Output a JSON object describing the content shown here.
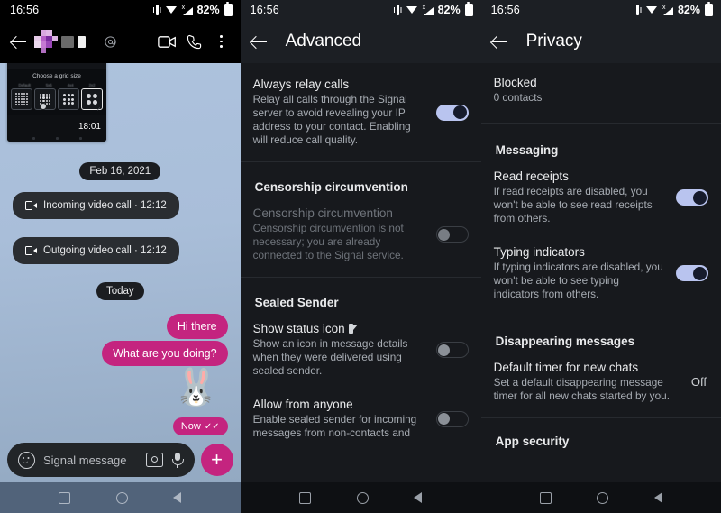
{
  "status_bar": {
    "time": "16:56",
    "battery_percent": "82%",
    "icons": [
      "vibrate-icon",
      "wifi-icon",
      "cellular-signal-icon",
      "battery-icon"
    ]
  },
  "left_panel": {
    "toolbar": {
      "back_icon": "back-arrow-icon",
      "avatar": "contact-avatar-pixelated",
      "contact_name_redacted": true,
      "at_icon": "mention-icon",
      "video_call_icon": "video-camera-icon",
      "voice_call_icon": "phone-icon",
      "overflow_icon": "more-vertical-icon"
    },
    "thumbnail": {
      "title": "Choose a grid size",
      "options": [
        "Default",
        "5x5",
        "4x4",
        "2x2"
      ],
      "selected_option": "2x2",
      "timestamp": "18:01"
    },
    "messages": [
      {
        "type": "date",
        "text": "Feb 16, 2021"
      },
      {
        "type": "call",
        "icon": "video-call-icon",
        "text": "Incoming video call · 12:12"
      },
      {
        "type": "call",
        "icon": "video-call-icon",
        "text": "Outgoing video call · 12:12"
      },
      {
        "type": "date",
        "text": "Today"
      },
      {
        "type": "outgoing",
        "text": "Hi there"
      },
      {
        "type": "outgoing",
        "text": "What are you doing?"
      },
      {
        "type": "emoji",
        "text": "🐰"
      },
      {
        "type": "status",
        "text": "Now",
        "delivery": "✓✓"
      }
    ],
    "composer": {
      "emoji_icon": "emoji-smiley-icon",
      "placeholder": "Signal message",
      "camera_icon": "camera-icon",
      "mic_icon": "microphone-icon",
      "attach_label": "+"
    },
    "accent_color": "#c4247f",
    "wallpaper_color": "#a9bed9"
  },
  "mid_panel": {
    "title": "Advanced",
    "back_icon": "back-arrow-icon",
    "sections": [
      {
        "header": null,
        "rows": [
          {
            "title": "Always relay calls",
            "subtitle": "Relay all calls through the Signal server to avoid revealing your IP address to your contact. Enabling will reduce call quality.",
            "control": "toggle",
            "state": "on",
            "dim": false
          }
        ]
      },
      {
        "header": "Censorship circumvention",
        "rows": [
          {
            "title": "Censorship circumvention",
            "subtitle": "Censorship circumvention is not necessary; you are already connected to the Signal service.",
            "control": "toggle",
            "state": "off",
            "dim": true
          }
        ]
      },
      {
        "header": "Sealed Sender",
        "rows": [
          {
            "title": "Show status icon",
            "title_icon": "sealed-sender-icon",
            "subtitle": "Show an icon in message details when they were delivered using sealed sender.",
            "control": "toggle",
            "state": "off",
            "dim": false
          },
          {
            "title": "Allow from anyone",
            "subtitle": "Enable sealed sender for incoming messages from non-contacts and",
            "control": "toggle",
            "state": "off",
            "dim": false
          }
        ]
      }
    ]
  },
  "right_panel": {
    "title": "Privacy",
    "back_icon": "back-arrow-icon",
    "sections": [
      {
        "header": null,
        "rows": [
          {
            "title": "Blocked",
            "subtitle": "0 contacts",
            "control": "none"
          }
        ]
      },
      {
        "header": "Messaging",
        "rows": [
          {
            "title": "Read receipts",
            "subtitle": "If read receipts are disabled, you won't be able to see read receipts from others.",
            "control": "toggle",
            "state": "on"
          },
          {
            "title": "Typing indicators",
            "subtitle": "If typing indicators are disabled, you won't be able to see typing indicators from others.",
            "control": "toggle",
            "state": "on"
          }
        ]
      },
      {
        "header": "Disappearing messages",
        "rows": [
          {
            "title": "Default timer for new chats",
            "subtitle": "Set a default disappearing message timer for all new chats started by you.",
            "control": "value",
            "value": "Off"
          }
        ]
      },
      {
        "header": "App security",
        "rows": []
      }
    ]
  },
  "nav_bar": {
    "recents_icon": "square-icon",
    "home_icon": "circle-icon",
    "back_icon": "triangle-back-icon"
  }
}
